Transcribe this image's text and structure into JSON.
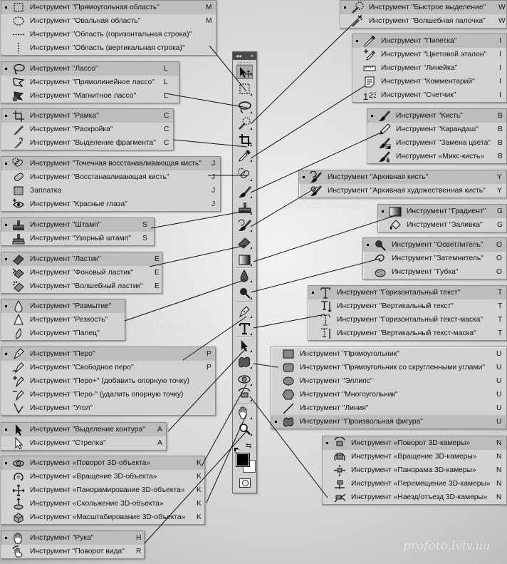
{
  "toolbar": {
    "collapse_glyph": "◂◂",
    "close_glyph": "×",
    "tools": [
      "move-tool-icon",
      "rect-marquee-tool-icon",
      "lasso-tool-icon",
      "quick-select-tool-icon",
      "crop-tool-icon",
      "eyedropper-tool-icon",
      "spot-healing-tool-icon",
      "brush-tool-icon",
      "stamp-tool-icon",
      "history-brush-tool-icon",
      "eraser-tool-icon",
      "gradient-tool-icon",
      "blur-tool-icon",
      "dodge-tool-icon",
      "pen-tool-icon",
      "type-tool-icon",
      "path-select-tool-icon",
      "shape-tool-icon",
      "rotate-3d-tool-icon",
      "orbit-3d-camera-tool-icon",
      "hand-tool-icon",
      "zoom-tool-icon"
    ],
    "foreground_color": "#000000",
    "background_color": "#ffffff",
    "swap_glyph": "⇆"
  },
  "flyouts": [
    {
      "id": "marquee",
      "items": [
        {
          "label": "Инструмент \"Прямоугольная область\"",
          "key": "M",
          "icon": "rect-marquee-icon",
          "active": true
        },
        {
          "label": "Инструмент \"Овальная область\"",
          "key": "M",
          "icon": "ellipse-marquee-icon"
        },
        {
          "label": "Инструмент \"Область (горизонтальная строка)\"",
          "key": "",
          "icon": "single-row-marquee-icon"
        },
        {
          "label": "Инструмент \"Область (вертикальная строка)\"",
          "key": "",
          "icon": "single-column-marquee-icon"
        }
      ]
    },
    {
      "id": "lasso",
      "items": [
        {
          "label": "Инструмент \"Лассо\"",
          "key": "L",
          "icon": "lasso-icon",
          "active": true
        },
        {
          "label": "Инструмент \"Прямолинейное лассо\"",
          "key": "L",
          "icon": "polygonal-lasso-icon"
        },
        {
          "label": "Инструмент \"Магнитное лассо\"",
          "key": "L",
          "icon": "magnetic-lasso-icon"
        }
      ]
    },
    {
      "id": "crop",
      "items": [
        {
          "label": "Инструмент \"Рамка\"",
          "key": "C",
          "icon": "crop-icon",
          "active": true
        },
        {
          "label": "Инструмент \"Раскройка\"",
          "key": "C",
          "icon": "slice-icon"
        },
        {
          "label": "Инструмент \"Выделение фрагмента\"",
          "key": "C",
          "icon": "slice-select-icon"
        }
      ]
    },
    {
      "id": "healing",
      "items": [
        {
          "label": "Инструмент \"Точечная восстанавливающая кисть\"",
          "key": "J",
          "icon": "spot-healing-brush-icon",
          "active": true
        },
        {
          "label": "Инструмент \"Восстанавливающая кисть\"",
          "key": "J",
          "icon": "healing-brush-icon"
        },
        {
          "label": "Заплатка",
          "key": "J",
          "icon": "patch-icon"
        },
        {
          "label": "Инструмент \"Красные глаза\"",
          "key": "J",
          "icon": "red-eye-icon"
        }
      ]
    },
    {
      "id": "stamp",
      "items": [
        {
          "label": "Инструмент \"Штамп\"",
          "key": "S",
          "icon": "clone-stamp-icon",
          "active": true
        },
        {
          "label": "Инструмент \"Узорный штамп\"",
          "key": "S",
          "icon": "pattern-stamp-icon"
        }
      ]
    },
    {
      "id": "eraser",
      "items": [
        {
          "label": "Инструмент \"Ластик\"",
          "key": "E",
          "icon": "eraser-icon",
          "active": true
        },
        {
          "label": "Инструмент \"Фоновый ластик\"",
          "key": "E",
          "icon": "background-eraser-icon"
        },
        {
          "label": "Инструмент \"Волшебный ластик\"",
          "key": "E",
          "icon": "magic-eraser-icon"
        }
      ]
    },
    {
      "id": "blur",
      "items": [
        {
          "label": "Инструмент \"Размытие\"",
          "key": "",
          "icon": "blur-icon",
          "active": true
        },
        {
          "label": "Инструмент \"Резкость\"",
          "key": "",
          "icon": "sharpen-icon"
        },
        {
          "label": "Инструмент \"Палец\"",
          "key": "",
          "icon": "smudge-icon"
        }
      ]
    },
    {
      "id": "pen",
      "items": [
        {
          "label": "Инструмент \"Перо\"",
          "key": "P",
          "icon": "pen-icon",
          "active": true
        },
        {
          "label": "Инструмент \"Свободное перо\"",
          "key": "P",
          "icon": "freeform-pen-icon"
        },
        {
          "label": "Инструмент \"Перо+\" (добавить опорную точку)",
          "key": "",
          "icon": "add-anchor-icon"
        },
        {
          "label": "Инструмент \"Перо-\" (удалить опорную точку)",
          "key": "",
          "icon": "delete-anchor-icon"
        },
        {
          "label": "Инструмент \"Угол\"",
          "key": "",
          "icon": "convert-point-icon"
        }
      ]
    },
    {
      "id": "path-select",
      "items": [
        {
          "label": "Инструмент \"Выделение контура\"",
          "key": "A",
          "icon": "path-selection-icon",
          "active": true
        },
        {
          "label": "Инструмент \"Стрелка\"",
          "key": "A",
          "icon": "direct-selection-icon"
        }
      ]
    },
    {
      "id": "3d-object",
      "items": [
        {
          "label": "Инструмент «Поворот 3D-объекта»",
          "key": "K",
          "icon": "3d-rotate-icon",
          "active": true
        },
        {
          "label": "Инструмент «Вращение 3D-объекта»",
          "key": "K",
          "icon": "3d-roll-icon"
        },
        {
          "label": "Инструмент «Панорамирование 3D-объекта»",
          "key": "K",
          "icon": "3d-pan-icon"
        },
        {
          "label": "Инструмент «Скольжение 3D-объекта»",
          "key": "K",
          "icon": "3d-slide-icon"
        },
        {
          "label": "Инструмент «Масштабирование 3D-объекта»",
          "key": "K",
          "icon": "3d-scale-icon"
        }
      ]
    },
    {
      "id": "hand",
      "items": [
        {
          "label": "Инструмент \"Рука\"",
          "key": "H",
          "icon": "hand-icon",
          "active": true
        },
        {
          "label": "Инструмент \"Поворот вида\"",
          "key": "R",
          "icon": "rotate-view-icon"
        }
      ]
    },
    {
      "id": "quick-select",
      "items": [
        {
          "label": "Инструмент \"Быстрое выделение\"",
          "key": "W",
          "icon": "quick-selection-icon",
          "active": true
        },
        {
          "label": "Инструмент \"Волшебная палочка\"",
          "key": "W",
          "icon": "magic-wand-icon"
        }
      ]
    },
    {
      "id": "eyedropper",
      "items": [
        {
          "label": "Инструмент \"Пипетка\"",
          "key": "I",
          "icon": "eyedropper-icon",
          "active": true
        },
        {
          "label": "Инструмент \"Цветовой эталон\"",
          "key": "I",
          "icon": "color-sampler-icon"
        },
        {
          "label": "Инструмент \"Линейка\"",
          "key": "I",
          "icon": "ruler-icon"
        },
        {
          "label": "Инструмент \"Комментарий\"",
          "key": "I",
          "icon": "note-icon"
        },
        {
          "label": "Инструмент \"Счетчик\"",
          "key": "I",
          "icon": "count-icon"
        }
      ]
    },
    {
      "id": "brush",
      "items": [
        {
          "label": "Инструмент \"Кисть\"",
          "key": "B",
          "icon": "brush-icon",
          "active": true
        },
        {
          "label": "Инструмент \"Карандаш\"",
          "key": "B",
          "icon": "pencil-icon"
        },
        {
          "label": "Инструмент \"Замена цвета\"",
          "key": "B",
          "icon": "color-replacement-icon"
        },
        {
          "label": "Инструмент «Микс-кисть»",
          "key": "B",
          "icon": "mixer-brush-icon"
        }
      ]
    },
    {
      "id": "history-brush",
      "items": [
        {
          "label": "Инструмент \"Архивная кисть\"",
          "key": "Y",
          "icon": "history-brush-icon",
          "active": true
        },
        {
          "label": "Инструмент \"Архивная художественная кисть\"",
          "key": "Y",
          "icon": "art-history-brush-icon"
        }
      ]
    },
    {
      "id": "gradient",
      "items": [
        {
          "label": "Инструмент \"Градиент\"",
          "key": "G",
          "icon": "gradient-icon",
          "active": true
        },
        {
          "label": "Инструмент \"Заливка\"",
          "key": "G",
          "icon": "paint-bucket-icon"
        }
      ]
    },
    {
      "id": "dodge",
      "items": [
        {
          "label": "Инструмент \"Осветлитель\"",
          "key": "O",
          "icon": "dodge-icon",
          "active": true
        },
        {
          "label": "Инструмент \"Затемнитель\"",
          "key": "O",
          "icon": "burn-icon"
        },
        {
          "label": "Инструмент \"Губка\"",
          "key": "O",
          "icon": "sponge-icon"
        }
      ]
    },
    {
      "id": "type",
      "items": [
        {
          "label": "Инструмент \"Горизонтальный текст\"",
          "key": "T",
          "icon": "horizontal-type-icon",
          "active": true
        },
        {
          "label": "Инструмент \"Вертикальный текст\"",
          "key": "T",
          "icon": "vertical-type-icon"
        },
        {
          "label": "Инструмент \"Горизонтальный текст-маска\"",
          "key": "T",
          "icon": "horizontal-type-mask-icon"
        },
        {
          "label": "Инструмент \"Вертикальный текст-маска\"",
          "key": "T",
          "icon": "vertical-type-mask-icon"
        }
      ]
    },
    {
      "id": "shape",
      "items": [
        {
          "label": "Инструмент \"Прямоугольник\"",
          "key": "U",
          "icon": "rectangle-shape-icon"
        },
        {
          "label": "Инструмент \"Прямоугольник со скругленными углами\"",
          "key": "U",
          "icon": "rounded-rectangle-icon"
        },
        {
          "label": "Инструмент \"Эллипс\"",
          "key": "U",
          "icon": "ellipse-shape-icon"
        },
        {
          "label": "Инструмент \"Многоугольник\"",
          "key": "U",
          "icon": "polygon-shape-icon"
        },
        {
          "label": "Инструмент \"Линия\"",
          "key": "U",
          "icon": "line-shape-icon"
        },
        {
          "label": "Инструмент \"Произвольная фигура\"",
          "key": "U",
          "icon": "custom-shape-icon",
          "active": true
        }
      ]
    },
    {
      "id": "3d-camera",
      "items": [
        {
          "label": "Инструмент «Поворот 3D-камеры»",
          "key": "N",
          "icon": "3d-camera-orbit-icon",
          "active": true
        },
        {
          "label": "Инструмент «Вращение 3D-камеры»",
          "key": "N",
          "icon": "3d-camera-roll-icon"
        },
        {
          "label": "Инструмент «Панорама 3D-камеры»",
          "key": "N",
          "icon": "3d-camera-pan-icon"
        },
        {
          "label": "Инструмент «Перемещение 3D-камеры»",
          "key": "N",
          "icon": "3d-camera-walk-icon"
        },
        {
          "label": "Инструмент «Наезд/отъезд 3D-камеры»",
          "key": "N",
          "icon": "3d-camera-zoom-icon"
        }
      ]
    }
  ],
  "watermarks": [
    "profoto.lviv.ua",
    "profoto.lviv.ua",
    "profoto.lviv.ua"
  ]
}
